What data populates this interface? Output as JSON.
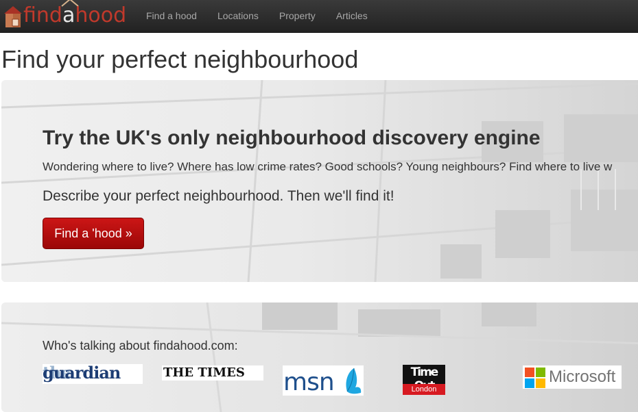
{
  "brand": {
    "name_part1": "find",
    "name_highlight": "a",
    "name_part2": "hood",
    "color_red": "#c0392b"
  },
  "nav": {
    "items": [
      {
        "label": "Find a hood"
      },
      {
        "label": "Locations"
      },
      {
        "label": "Property"
      },
      {
        "label": "Articles"
      }
    ]
  },
  "page": {
    "title": "Find your perfect neighbourhood"
  },
  "hero": {
    "heading": "Try the UK's only neighbourhood discovery engine",
    "lead": "Wondering where to live? Where has low crime rates? Good schools? Young neighbours? Find where to live w",
    "subtext": "Describe your perfect neighbourhood. Then we'll find it!",
    "button_label": "Find a 'hood »",
    "button_color": "#b20d0d"
  },
  "press": {
    "heading": "Who's talking about findahood.com:",
    "logos": {
      "guardian_the": "the",
      "guardian_name": "guardian",
      "times": "THE TIMES",
      "msn": "msn",
      "timeout": "Time Out",
      "timeout_city": "London",
      "microsoft": "Microsoft"
    }
  }
}
